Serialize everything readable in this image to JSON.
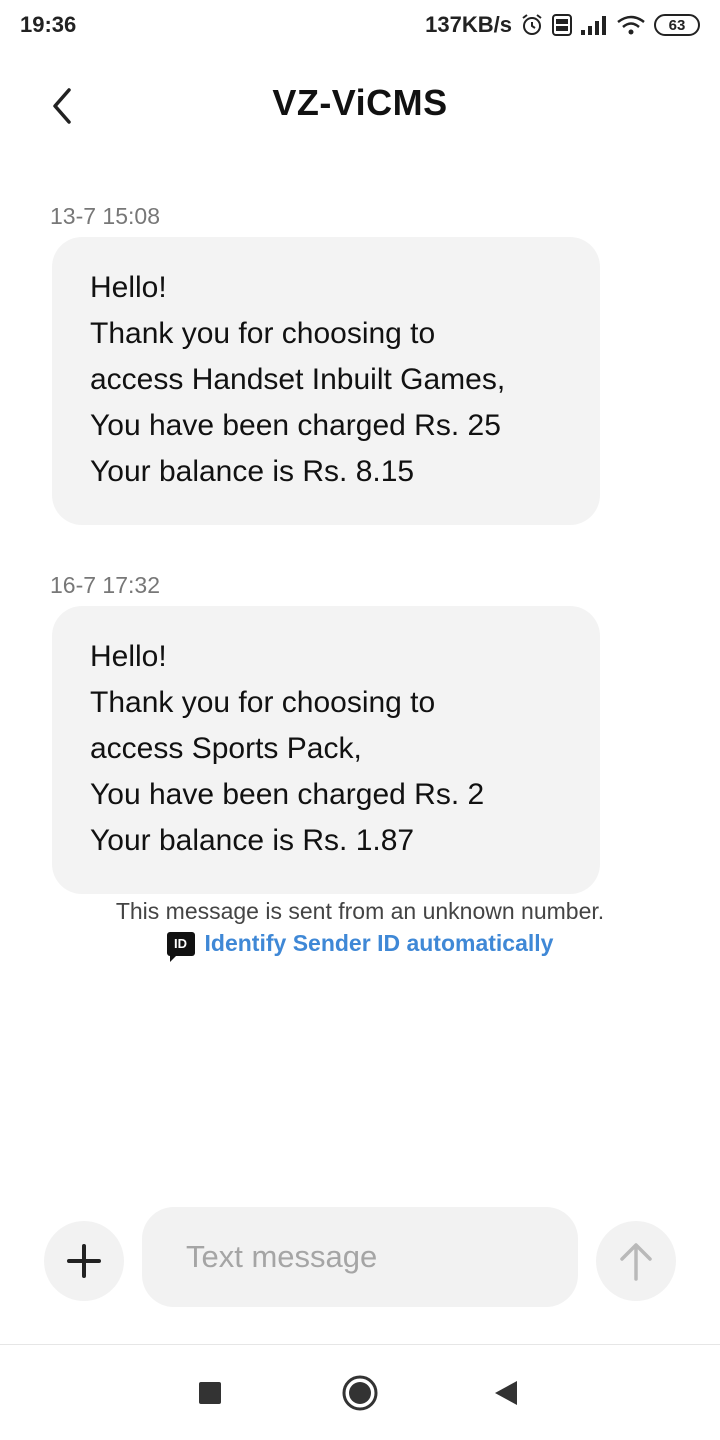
{
  "status_bar": {
    "time": "19:36",
    "network_speed": "137KB/s",
    "battery_level": "63",
    "icons": [
      "alarm-icon",
      "volte-icon",
      "signal-icon",
      "wifi-icon",
      "battery-icon"
    ]
  },
  "header": {
    "title": "VZ-ViCMS",
    "back_icon": "chevron-left-icon"
  },
  "messages": [
    {
      "timestamp": "13-7 15:08",
      "lines": [
        "Hello!",
        "Thank you for choosing to",
        "access Handset Inbuilt Games,",
        "You have been charged Rs. 25",
        "Your balance is Rs. 8.15"
      ]
    },
    {
      "timestamp": "16-7 17:32",
      "lines": [
        "Hello!",
        "Thank you for choosing to",
        "access Sports Pack,",
        "You have been charged Rs. 2",
        "Your balance is Rs. 1.87"
      ]
    }
  ],
  "notice": {
    "text": "This message is sent from an unknown number.",
    "id_badge": "ID",
    "link": "Identify Sender ID automatically"
  },
  "composer": {
    "placeholder": "Text message",
    "add_icon": "plus-icon",
    "send_icon": "arrow-up-icon"
  },
  "nav": {
    "icons": [
      "recents-square-icon",
      "home-circle-icon",
      "back-triangle-icon"
    ]
  },
  "colors": {
    "bubble": "#f3f3f3",
    "link": "#3f88d6",
    "timestamp": "#777777"
  }
}
